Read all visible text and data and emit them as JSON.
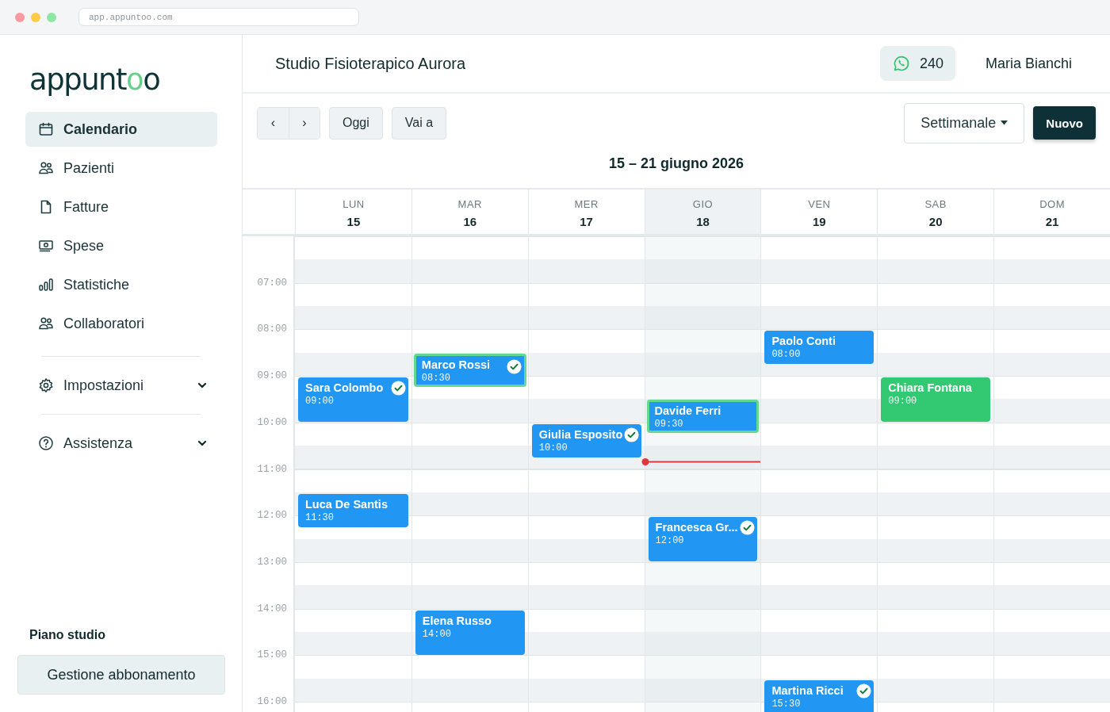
{
  "browser": {
    "url": "app.appuntoo.com"
  },
  "sidebar": {
    "logo": "appuntoo",
    "items": [
      {
        "label": "Calendario",
        "selected": true
      },
      {
        "label": "Pazienti",
        "selected": false
      },
      {
        "label": "Fatture",
        "selected": false
      },
      {
        "label": "Spese",
        "selected": false
      },
      {
        "label": "Statistiche",
        "selected": false
      },
      {
        "label": "Collaboratori",
        "selected": false
      }
    ],
    "sections": [
      {
        "label": "Impostazioni",
        "expanded": false
      },
      {
        "label": "Assistenza",
        "expanded": false
      }
    ],
    "plan_label": "Piano studio",
    "plan_button": "Gestione abbonamento"
  },
  "header": {
    "title": "Studio Fisioterapico Aurora",
    "whatsapp_count": "240",
    "user": "Maria Bianchi"
  },
  "toolbar": {
    "prev": "‹",
    "next": "›",
    "today": "Oggi",
    "goto": "Vai a",
    "view": "Settimanale",
    "new": "Nuovo"
  },
  "calendar": {
    "range": "15 – 21 giugno 2026",
    "hours": [
      "07:00",
      "08:00",
      "09:00",
      "10:00",
      "11:00",
      "12:00",
      "13:00",
      "14:00",
      "15:00",
      "16:00"
    ],
    "now_indicator": true,
    "days": [
      {
        "name": "LUN",
        "date": "15",
        "selected": false,
        "events": [
          {
            "name": "Sara Colombo",
            "time": "09:00",
            "kind": "long",
            "color": "#2196f3",
            "confirmed": true,
            "highlighted": false
          },
          {
            "name": "Luca De Santis",
            "time": "11:30",
            "kind": "short",
            "color": "#2196f3",
            "confirmed": false,
            "highlighted": false
          }
        ]
      },
      {
        "name": "MAR",
        "date": "16",
        "selected": false,
        "events": [
          {
            "name": "Marco Rossi",
            "time": "08:30",
            "kind": "short",
            "color": "#2196f3",
            "confirmed": true,
            "highlighted": true
          },
          {
            "name": "Elena Russo",
            "time": "14:00",
            "kind": "long",
            "color": "#2196f3",
            "confirmed": false,
            "highlighted": false
          }
        ]
      },
      {
        "name": "MER",
        "date": "17",
        "selected": false,
        "events": [
          {
            "name": "Giulia Esposito",
            "time": "10:00",
            "kind": "short",
            "color": "#2196f3",
            "confirmed": true,
            "highlighted": false
          }
        ]
      },
      {
        "name": "GIO",
        "date": "18",
        "selected": true,
        "events": [
          {
            "name": "Davide Ferri",
            "time": "09:30",
            "kind": "short",
            "color": "#2196f3",
            "confirmed": false,
            "highlighted": true
          },
          {
            "name": "Francesca Gr...",
            "time": "12:00",
            "kind": "long",
            "color": "#2196f3",
            "confirmed": true,
            "highlighted": false
          }
        ]
      },
      {
        "name": "VEN",
        "date": "19",
        "selected": false,
        "events": [
          {
            "name": "Paolo Conti",
            "time": "08:00",
            "kind": "short",
            "color": "#2196f3",
            "confirmed": false,
            "highlighted": false
          },
          {
            "name": "Martina Ricci",
            "time": "15:30",
            "kind": "long",
            "color": "#2196f3",
            "confirmed": true,
            "highlighted": false
          }
        ]
      },
      {
        "name": "SAB",
        "date": "20",
        "selected": false,
        "events": [
          {
            "name": "Chiara Fontana",
            "time": "09:00",
            "kind": "long",
            "color": "#33c972",
            "confirmed": false,
            "highlighted": false
          }
        ]
      },
      {
        "name": "DOM",
        "date": "21",
        "selected": false
      }
    ]
  }
}
